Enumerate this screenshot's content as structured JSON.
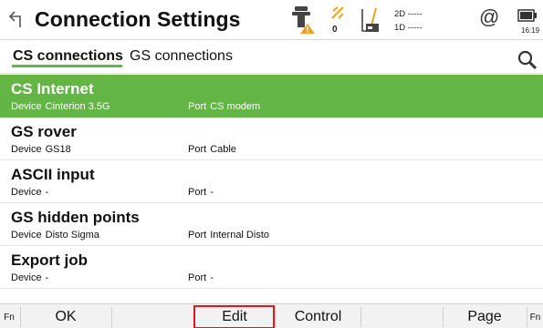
{
  "header": {
    "title": "Connection Settings",
    "rtk_count": "0",
    "sat_2d": "2D -----",
    "sat_1d": "1D -----",
    "clock": "16:19"
  },
  "tabs": [
    {
      "label": "CS connections",
      "active": true
    },
    {
      "label": "GS connections",
      "active": false
    }
  ],
  "list": {
    "device_label": "Device",
    "port_label": "Port",
    "items": [
      {
        "name": "CS Internet",
        "device": "Cinterion 3.5G",
        "port": "CS modem",
        "selected": true
      },
      {
        "name": "GS rover",
        "device": "GS18",
        "port": "Cable",
        "selected": false
      },
      {
        "name": "ASCII input",
        "device": "-",
        "port": "-",
        "selected": false
      },
      {
        "name": "GS hidden points",
        "device": "Disto Sigma",
        "port": "Internal Disto",
        "selected": false
      },
      {
        "name": "Export job",
        "device": "-",
        "port": "-",
        "selected": false
      }
    ]
  },
  "toolbar": {
    "fn_left": "Fn",
    "ok": "OK",
    "edit": "Edit",
    "control": "Control",
    "page": "Page",
    "fn_right": "Fn"
  },
  "colors": {
    "accent": "#63b545",
    "highlight": "#e0191e"
  },
  "icons": [
    "back-icon",
    "rover-warning-icon",
    "rtk-icon",
    "radio-antenna-icon",
    "at-icon",
    "battery-icon",
    "search-icon"
  ]
}
